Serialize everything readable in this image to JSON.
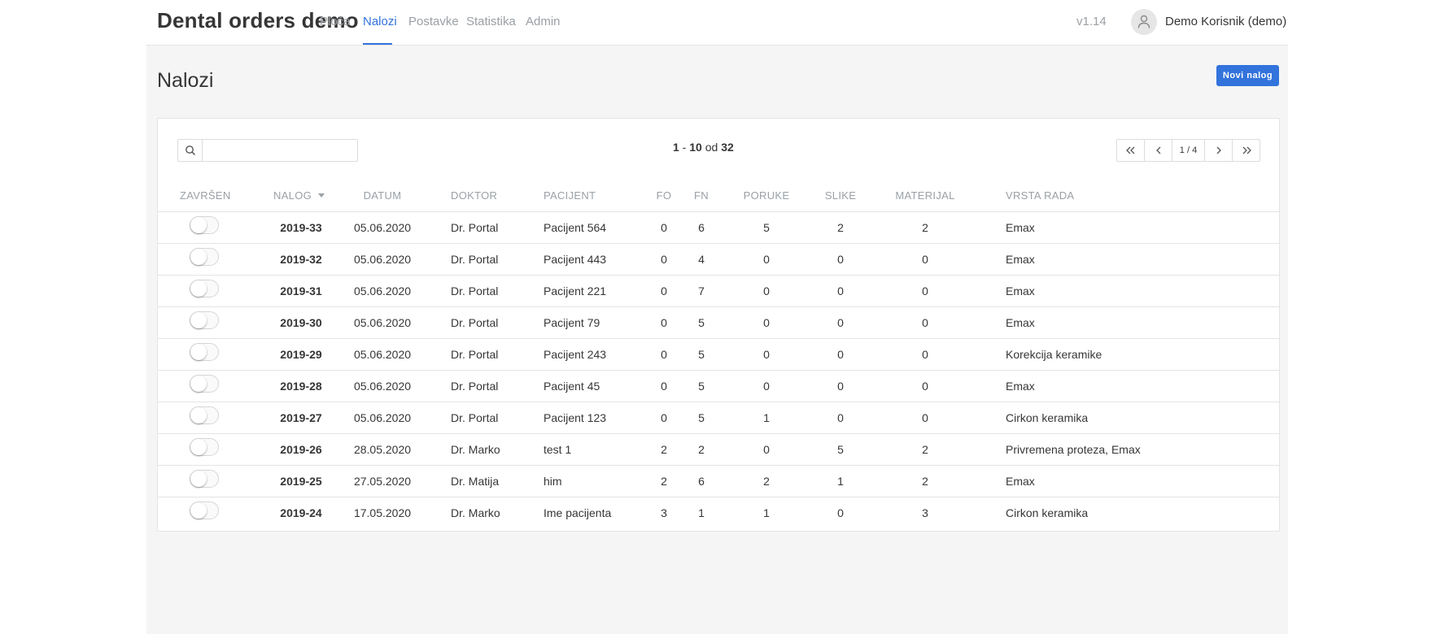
{
  "nav": {
    "brand": "Dental orders demo",
    "items": [
      {
        "label": "Ploča",
        "active": false
      },
      {
        "label": "Nalozi",
        "active": true
      },
      {
        "label": "Postavke",
        "active": false
      },
      {
        "label": "Statistika",
        "active": false
      },
      {
        "label": "Admin",
        "active": false
      }
    ],
    "version": "v1.14",
    "user": "Demo Korisnik (demo)"
  },
  "page": {
    "title": "Nalozi",
    "new_button": "Novi nalog"
  },
  "search": {
    "value": "",
    "placeholder": ""
  },
  "pagination": {
    "from": "1",
    "to": "10",
    "od": "od",
    "total": "32",
    "page_info": "1 / 4"
  },
  "columns": {
    "zavrsen": "ZAVRŠEN",
    "nalog": "NALOG",
    "datum": "DATUM",
    "doktor": "DOKTOR",
    "pacijent": "PACIJENT",
    "fo": "FO",
    "fn": "FN",
    "poruke": "PORUKE",
    "slike": "SLIKE",
    "materijal": "MATERIJAL",
    "vrsta_rada": "VRSTA RADA"
  },
  "rows": [
    {
      "done": false,
      "nalog": "2019-33",
      "datum": "05.06.2020",
      "doktor": "Dr. Portal",
      "pacijent": "Pacijent 564",
      "fo": "0",
      "fn": "6",
      "poruke": "5",
      "slike": "2",
      "materijal": "2",
      "vrsta": "Emax"
    },
    {
      "done": false,
      "nalog": "2019-32",
      "datum": "05.06.2020",
      "doktor": "Dr. Portal",
      "pacijent": "Pacijent 443",
      "fo": "0",
      "fn": "4",
      "poruke": "0",
      "slike": "0",
      "materijal": "0",
      "vrsta": "Emax"
    },
    {
      "done": false,
      "nalog": "2019-31",
      "datum": "05.06.2020",
      "doktor": "Dr. Portal",
      "pacijent": "Pacijent 221",
      "fo": "0",
      "fn": "7",
      "poruke": "0",
      "slike": "0",
      "materijal": "0",
      "vrsta": "Emax"
    },
    {
      "done": false,
      "nalog": "2019-30",
      "datum": "05.06.2020",
      "doktor": "Dr. Portal",
      "pacijent": "Pacijent 79",
      "fo": "0",
      "fn": "5",
      "poruke": "0",
      "slike": "0",
      "materijal": "0",
      "vrsta": "Emax"
    },
    {
      "done": false,
      "nalog": "2019-29",
      "datum": "05.06.2020",
      "doktor": "Dr. Portal",
      "pacijent": "Pacijent 243",
      "fo": "0",
      "fn": "5",
      "poruke": "0",
      "slike": "0",
      "materijal": "0",
      "vrsta": "Korekcija keramike"
    },
    {
      "done": false,
      "nalog": "2019-28",
      "datum": "05.06.2020",
      "doktor": "Dr. Portal",
      "pacijent": "Pacijent 45",
      "fo": "0",
      "fn": "5",
      "poruke": "0",
      "slike": "0",
      "materijal": "0",
      "vrsta": "Emax"
    },
    {
      "done": false,
      "nalog": "2019-27",
      "datum": "05.06.2020",
      "doktor": "Dr. Portal",
      "pacijent": "Pacijent 123",
      "fo": "0",
      "fn": "5",
      "poruke": "1",
      "slike": "0",
      "materijal": "0",
      "vrsta": "Cirkon keramika"
    },
    {
      "done": false,
      "nalog": "2019-26",
      "datum": "28.05.2020",
      "doktor": "Dr. Marko",
      "pacijent": "test 1",
      "fo": "2",
      "fn": "2",
      "poruke": "0",
      "slike": "5",
      "materijal": "2",
      "vrsta": "Privremena proteza, Emax"
    },
    {
      "done": false,
      "nalog": "2019-25",
      "datum": "27.05.2020",
      "doktor": "Dr. Matija",
      "pacijent": "him",
      "fo": "2",
      "fn": "6",
      "poruke": "2",
      "slike": "1",
      "materijal": "2",
      "vrsta": "Emax"
    },
    {
      "done": false,
      "nalog": "2019-24",
      "datum": "17.05.2020",
      "doktor": "Dr. Marko",
      "pacijent": "Ime pacijenta",
      "fo": "3",
      "fn": "1",
      "poruke": "1",
      "slike": "0",
      "materijal": "3",
      "vrsta": "Cirkon keramika"
    }
  ],
  "colors": {
    "accent": "#3273dc",
    "muted": "#9aa0a6",
    "text": "#363636",
    "background": "#f5f5f5"
  },
  "icons": {
    "search": "search-icon",
    "avatar": "user-icon",
    "first": "chevrons-left-icon",
    "prev": "chevron-left-icon",
    "next": "chevron-right-icon",
    "last": "chevrons-right-icon"
  }
}
